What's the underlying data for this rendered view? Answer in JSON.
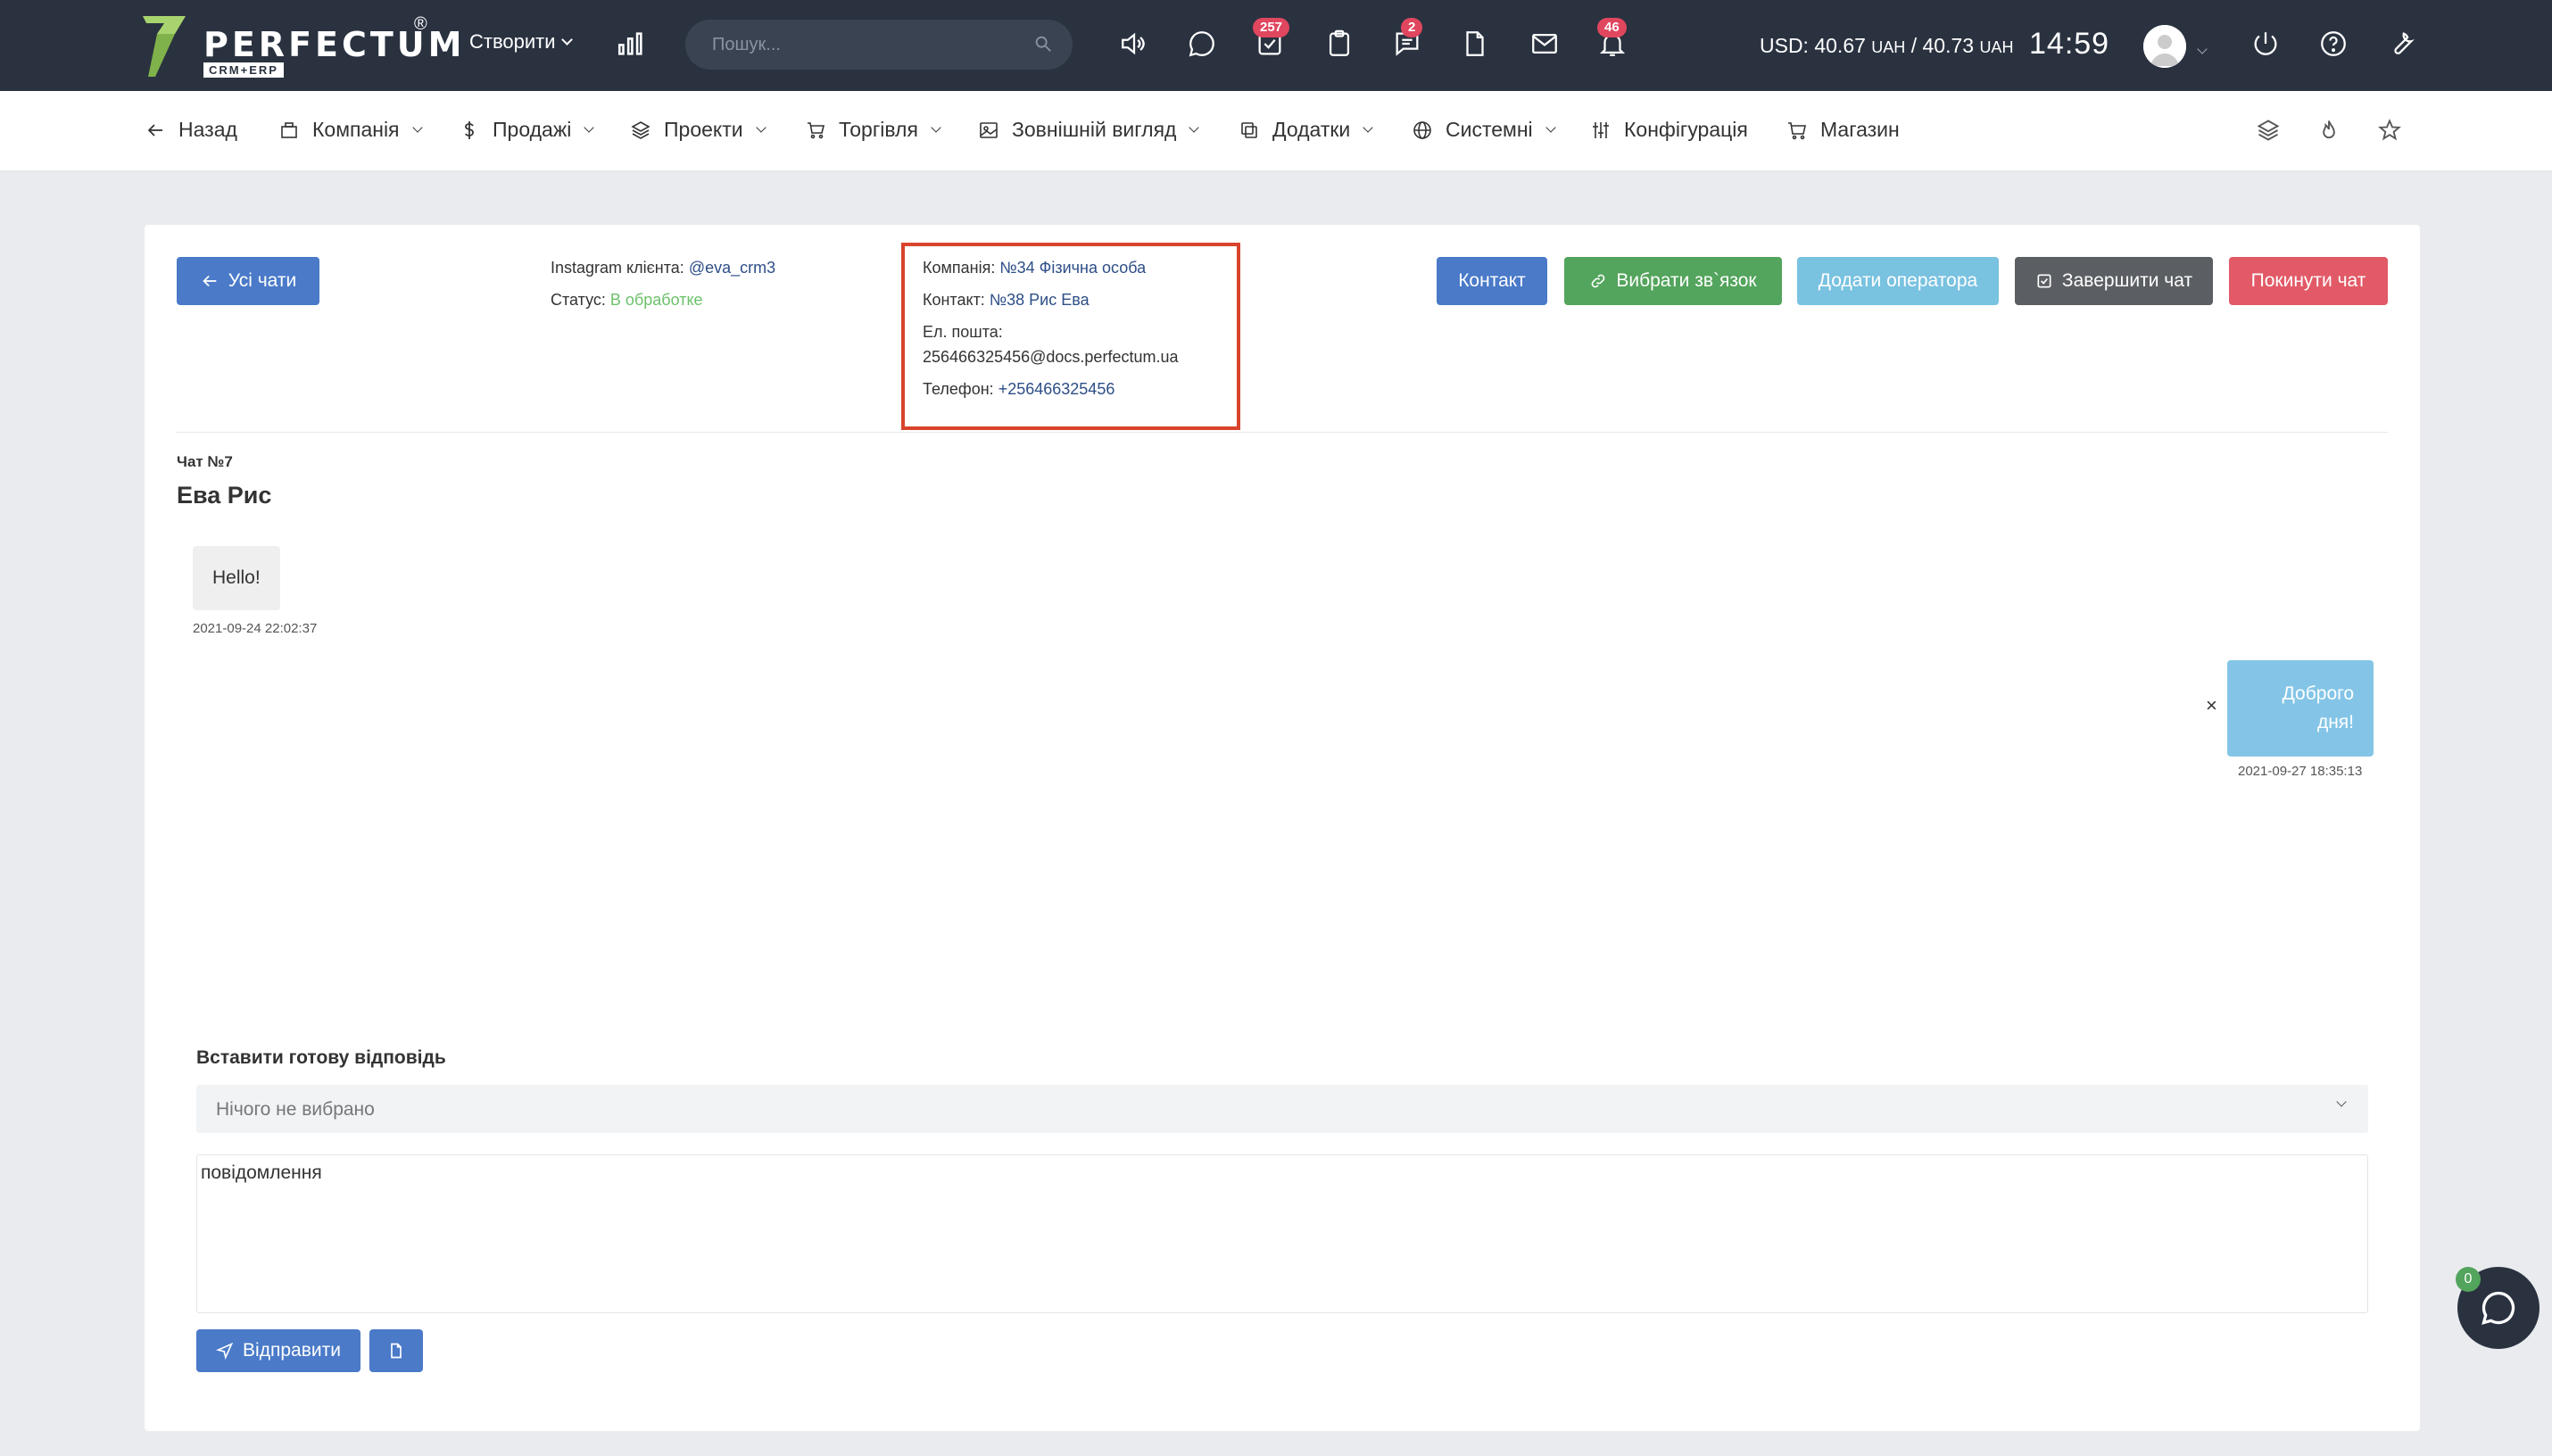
{
  "brand": {
    "name": "PERFECTUM",
    "sub": "CRM+ERP",
    "reg": "®"
  },
  "topbar": {
    "create_label": "Створити",
    "search_placeholder": "Пошук...",
    "badges": {
      "tasks": "257",
      "chat": "2",
      "notifications": "46"
    },
    "currency": {
      "usd": "USD:",
      "v1": "40.67",
      "u1": "UAH",
      "sep": "/",
      "v2": "40.73",
      "u2": "UAH"
    },
    "time": "14:59"
  },
  "nav": {
    "back": "Назад",
    "items": [
      "Компанія",
      "Продажі",
      "Проекти",
      "Торгівля",
      "Зовнішній вигляд",
      "Додатки",
      "Системні",
      "Конфігурація",
      "Магазин"
    ]
  },
  "chat": {
    "all_chats": "Усі чати",
    "instagram_label": "Instagram клієнта:",
    "instagram_value": "@eva_crm3",
    "status_label": "Статус:",
    "status_value": "В обработке",
    "company_label": "Компанія:",
    "company_value": "№34 Фізична особа",
    "contact_label": "Контакт:",
    "contact_value": "№38 Рис Ева",
    "email_label": "Ел. пошта:",
    "email_value": "256466325456@docs.perfectum.ua",
    "phone_label": "Телефон:",
    "phone_value": "+256466325456",
    "buttons": {
      "contact": "Контакт",
      "choose_link": "Вибрати зв`язок",
      "add_operator": "Додати оператора",
      "finish": "Завершити чат",
      "leave": "Покинути чат"
    },
    "number": "Чат №7",
    "name": "Ева Рис",
    "messages": [
      {
        "text": "Hello!",
        "time": "2021-09-24 22:02:37"
      },
      {
        "text": "Доброго дня!",
        "time": "2021-09-27 18:35:13"
      }
    ],
    "reply_label": "Вставити готову відповідь",
    "reply_placeholder": "Нічого не вибрано",
    "message_placeholder": "повідомлення",
    "send": "Відправити",
    "fab_badge": "0"
  },
  "colors": {
    "topbar": "#2a3240",
    "primary": "#4a7ac8",
    "success": "#53a45c",
    "info": "#79c2e0",
    "dark": "#5b5f63",
    "danger": "#e25a67",
    "highlight": "#d9432c"
  }
}
